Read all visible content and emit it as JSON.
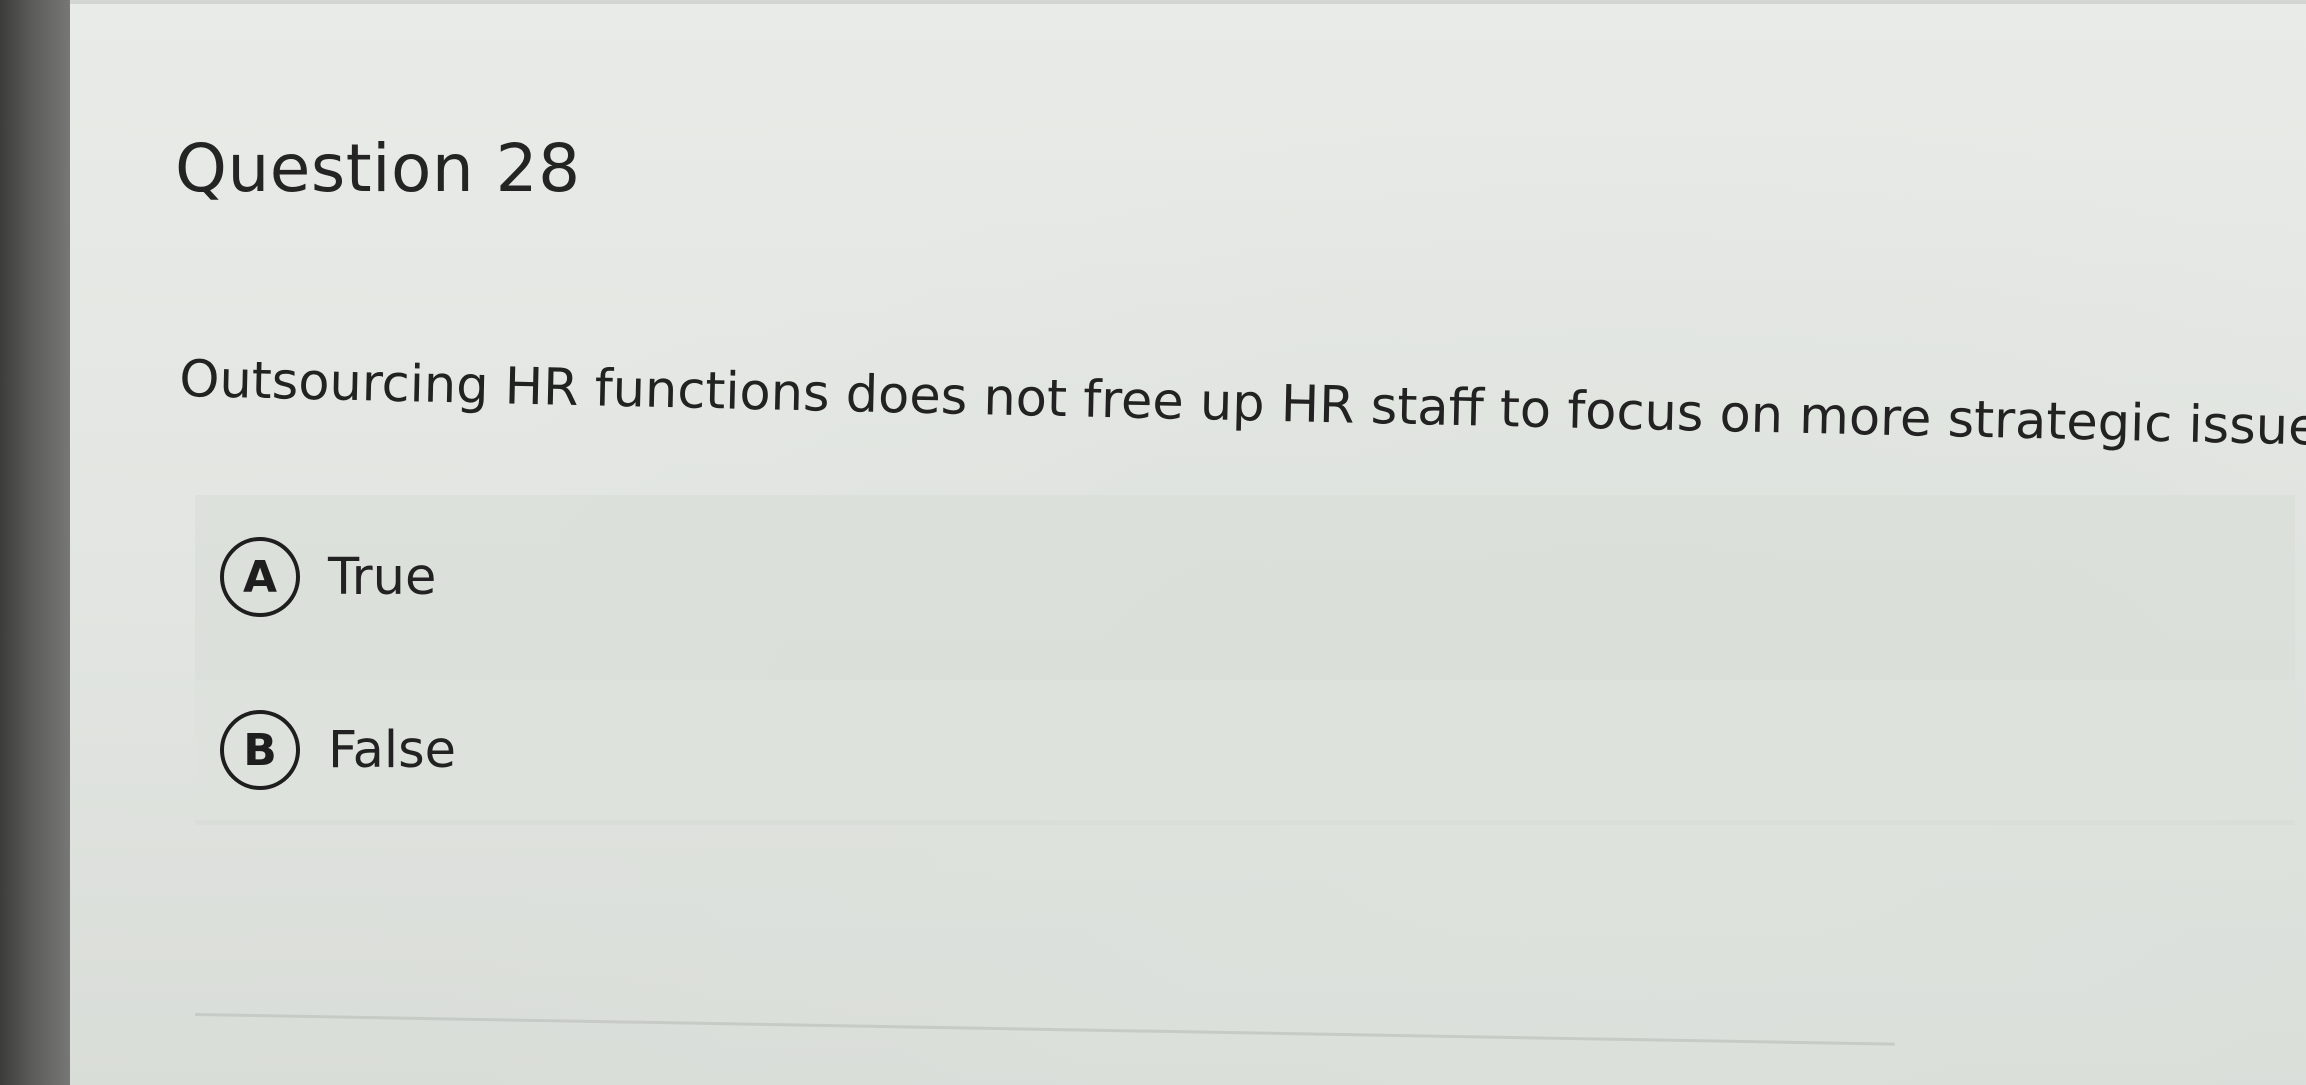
{
  "question": {
    "title": "Question 28",
    "text": "Outsourcing HR functions does not free up HR staff to focus on more strategic issues."
  },
  "options": [
    {
      "letter": "A",
      "label": "True"
    },
    {
      "letter": "B",
      "label": "False"
    }
  ]
}
